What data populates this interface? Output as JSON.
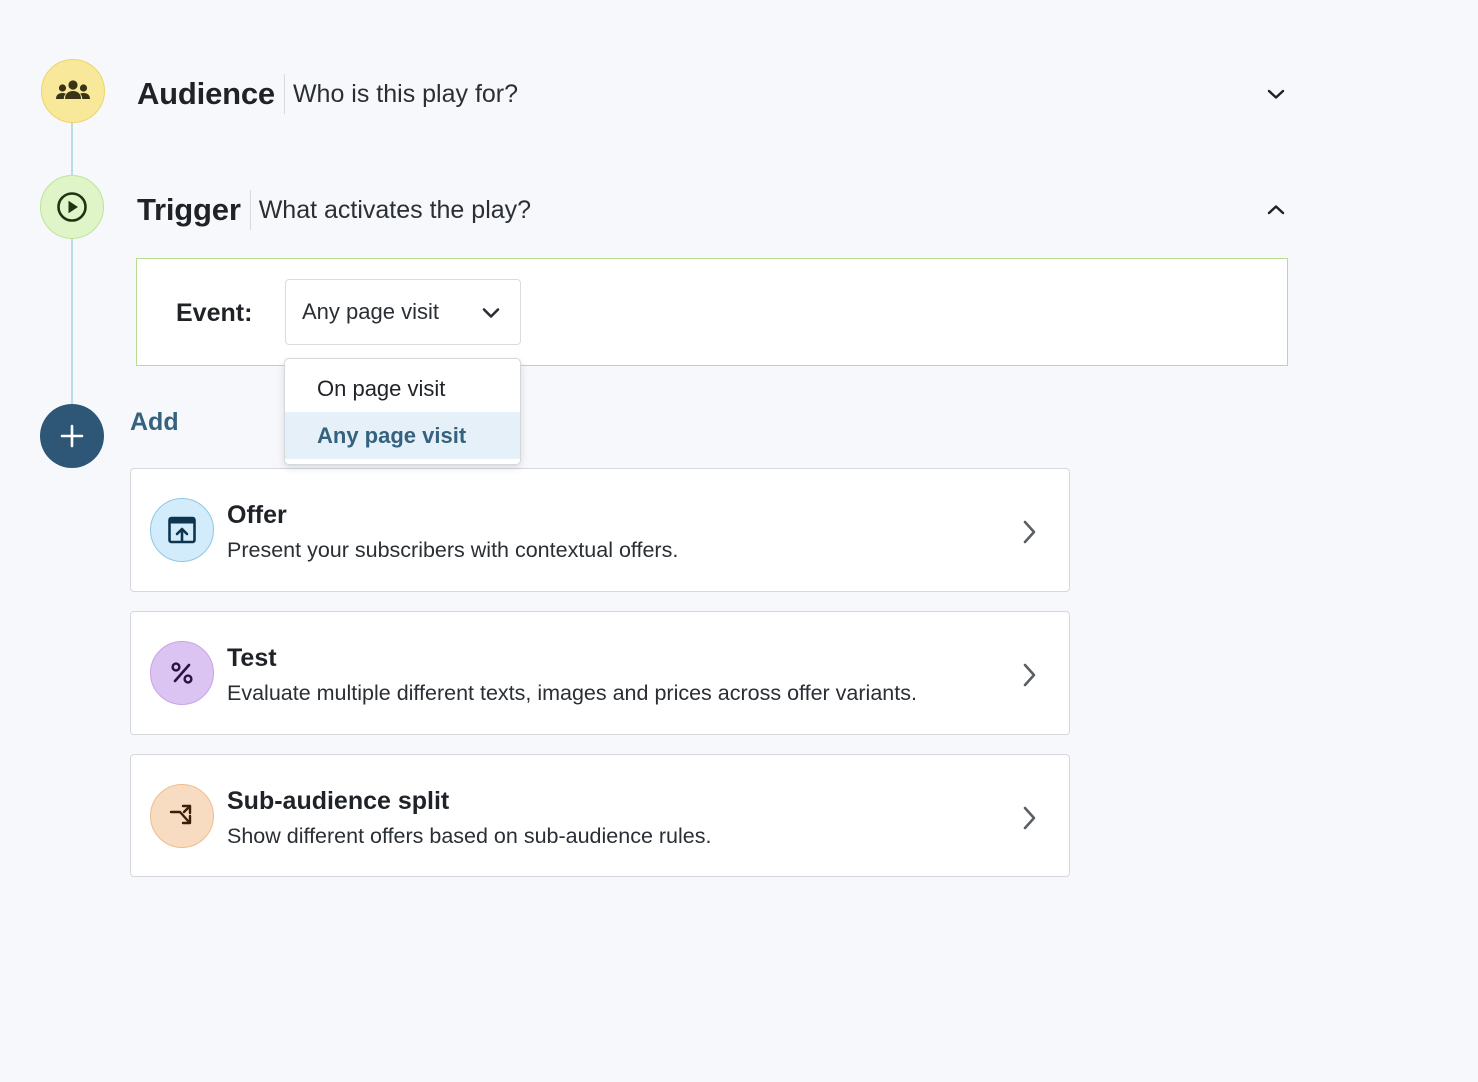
{
  "steps": {
    "audience": {
      "title": "Audience",
      "subtitle": "Who is this play for?",
      "icon": "people-icon",
      "expanded": false
    },
    "trigger": {
      "title": "Trigger",
      "subtitle": "What activates the play?",
      "icon": "play-circle-icon",
      "expanded": true
    }
  },
  "trigger_config": {
    "event_label": "Event:",
    "event_value": "Any page visit",
    "options": [
      {
        "label": "On page visit",
        "selected": false
      },
      {
        "label": "Any page visit",
        "selected": true
      }
    ]
  },
  "add": {
    "label": "Add",
    "icon": "plus-icon"
  },
  "cards": [
    {
      "title": "Offer",
      "description": "Present your subscribers with contextual offers.",
      "icon": "offer-upload-icon"
    },
    {
      "title": "Test",
      "description": "Evaluate multiple different texts, images and prices across offer variants.",
      "icon": "percent-icon"
    },
    {
      "title": "Sub-audience split",
      "description": "Show different offers based on sub-audience rules.",
      "icon": "split-arrow-icon"
    }
  ],
  "colors": {
    "audience": "#f8e99a",
    "trigger": "#dff5c8",
    "add": "#2e5677",
    "accent": "#35627f",
    "offer": "#d3ecfb",
    "test": "#dcc4f2",
    "split": "#f8dcc2"
  }
}
